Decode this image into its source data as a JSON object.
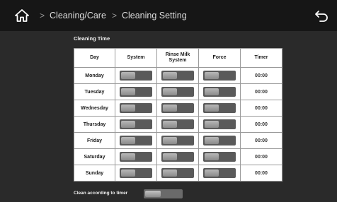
{
  "header": {
    "breadcrumb": [
      "Cleaning/Care",
      "Cleaning Setting"
    ],
    "home_icon": "home-icon",
    "back_icon": "back-icon"
  },
  "section": {
    "title": "Cleaning Time"
  },
  "table": {
    "columns": [
      "Day",
      "System",
      "Rinse Milk System",
      "Force",
      "Timer"
    ],
    "rows": [
      {
        "day": "Monday",
        "system": "off",
        "rinse_milk_system": "off",
        "force": "off",
        "timer": "00:00"
      },
      {
        "day": "Tuesday",
        "system": "off",
        "rinse_milk_system": "off",
        "force": "off",
        "timer": "00:00"
      },
      {
        "day": "Wednesday",
        "system": "off",
        "rinse_milk_system": "off",
        "force": "off",
        "timer": "00:00"
      },
      {
        "day": "Thursday",
        "system": "off",
        "rinse_milk_system": "off",
        "force": "off",
        "timer": "00:00"
      },
      {
        "day": "Friday",
        "system": "off",
        "rinse_milk_system": "off",
        "force": "off",
        "timer": "00:00"
      },
      {
        "day": "Saturday",
        "system": "off",
        "rinse_milk_system": "off",
        "force": "off",
        "timer": "00:00"
      },
      {
        "day": "Sunday",
        "system": "off",
        "rinse_milk_system": "off",
        "force": "off",
        "timer": "00:00"
      }
    ]
  },
  "footer": {
    "label": "Clean according to timer",
    "toggle_state": "off"
  },
  "colors": {
    "background": "#2a2a2a",
    "topbar": "#161616",
    "table_bg": "#ffffff",
    "toggle_track": "#5a5a5a"
  }
}
